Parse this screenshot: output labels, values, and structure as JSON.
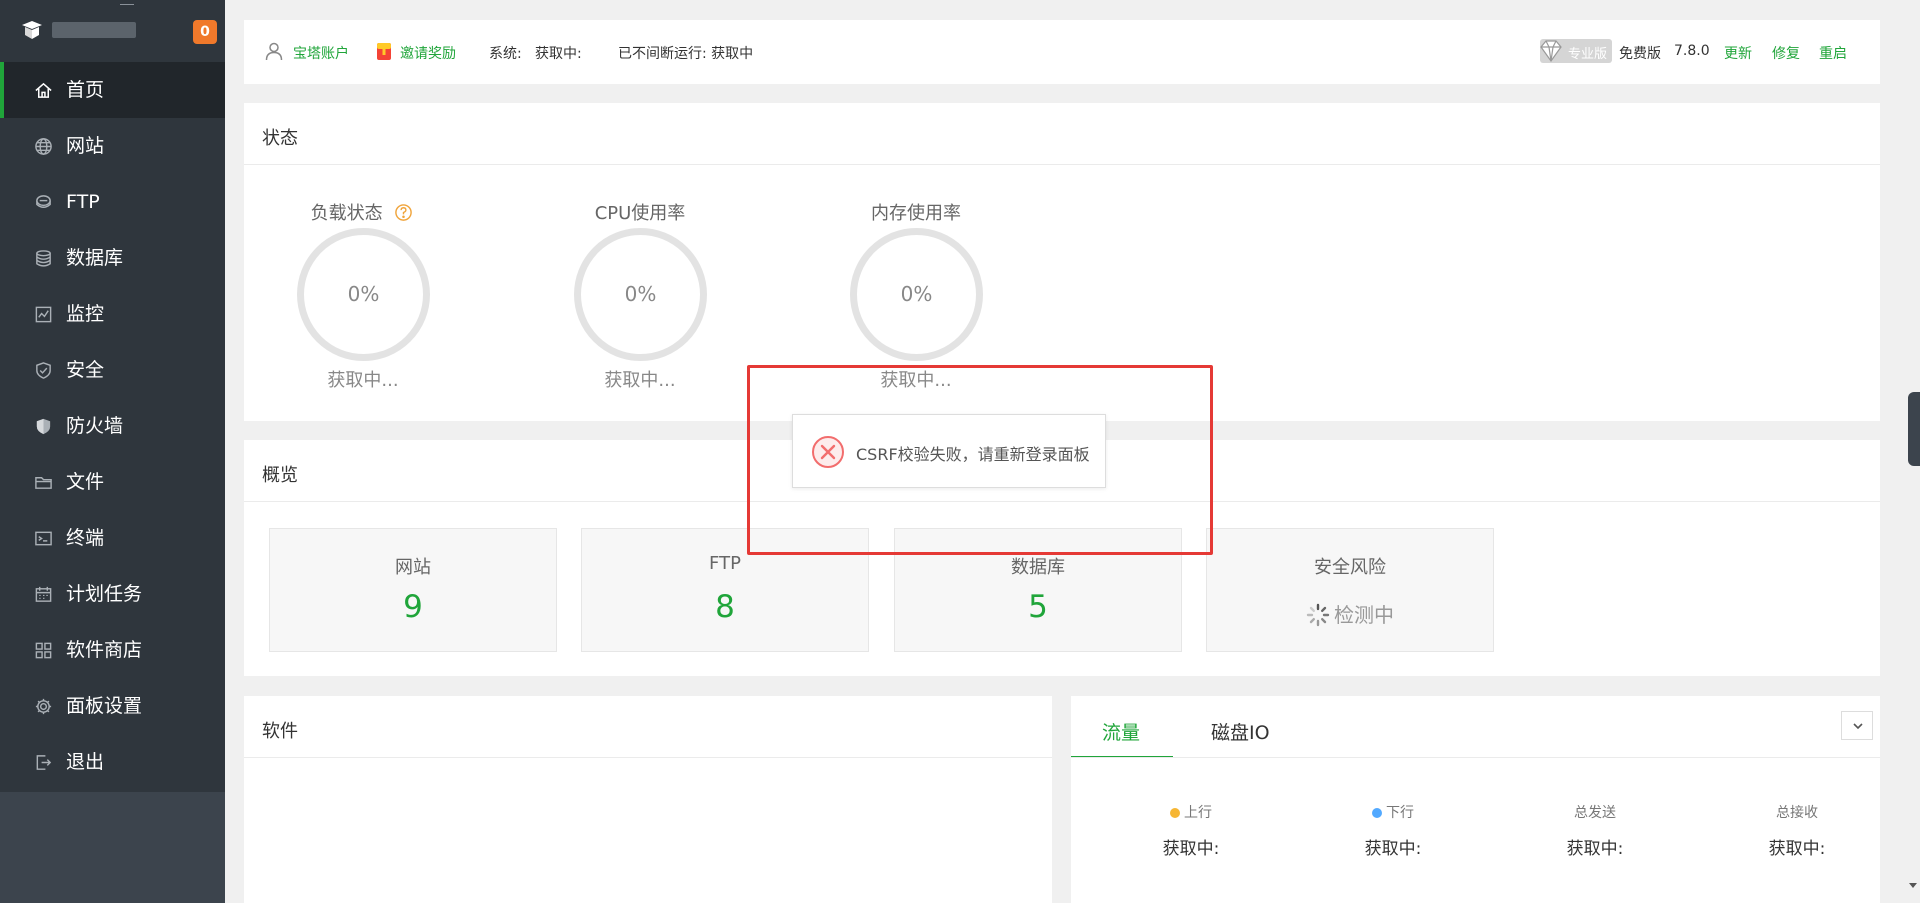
{
  "sidebar": {
    "badge": "0",
    "items": [
      {
        "label": "首页",
        "icon": "home-icon"
      },
      {
        "label": "网站",
        "icon": "globe-icon"
      },
      {
        "label": "FTP",
        "icon": "ftp-icon"
      },
      {
        "label": "数据库",
        "icon": "database-icon"
      },
      {
        "label": "监控",
        "icon": "monitor-icon"
      },
      {
        "label": "安全",
        "icon": "shield-check-icon"
      },
      {
        "label": "防火墙",
        "icon": "firewall-shield-icon"
      },
      {
        "label": "文件",
        "icon": "folder-icon"
      },
      {
        "label": "终端",
        "icon": "terminal-icon"
      },
      {
        "label": "计划任务",
        "icon": "calendar-icon"
      },
      {
        "label": "软件商店",
        "icon": "grid-icon"
      },
      {
        "label": "面板设置",
        "icon": "gear-icon"
      },
      {
        "label": "退出",
        "icon": "logout-icon"
      }
    ]
  },
  "topbar": {
    "account": "宝塔账户",
    "invite": "邀请奖励",
    "system_label": "系统:",
    "system_value": "获取中:",
    "uptime": "已不间断运行: 获取中",
    "pro_badge": "专业版",
    "edition": "免费版",
    "version": "7.8.0",
    "update": "更新",
    "repair": "修复",
    "restart": "重启"
  },
  "status": {
    "title": "状态",
    "gauges": [
      {
        "label": "负载状态",
        "value": "0%",
        "status": "获取中..."
      },
      {
        "label": "CPU使用率",
        "value": "0%",
        "status": "获取中..."
      },
      {
        "label": "内存使用率",
        "value": "0%",
        "status": "获取中..."
      }
    ]
  },
  "overview": {
    "title": "概览",
    "boxes": [
      {
        "label": "网站",
        "value": "9"
      },
      {
        "label": "FTP",
        "value": "8"
      },
      {
        "label": "数据库",
        "value": "5"
      },
      {
        "label": "安全风险",
        "value": "检测中"
      }
    ]
  },
  "software": {
    "title": "软件"
  },
  "traffic": {
    "tabs": [
      "流量",
      "磁盘IO"
    ],
    "cols": [
      {
        "label": "上行",
        "value": "获取中:",
        "dot": "#f6b634"
      },
      {
        "label": "下行",
        "value": "获取中:",
        "dot": "#52a9ff"
      },
      {
        "label": "总发送",
        "value": "获取中:"
      },
      {
        "label": "总接收",
        "value": "获取中:"
      }
    ]
  },
  "toast": {
    "message": "CSRF校验失败，请重新登录面板"
  },
  "colors": {
    "accent": "#20a53a",
    "sidebar": "#2f363d",
    "error": "#e53935",
    "badge": "#f0792b"
  }
}
